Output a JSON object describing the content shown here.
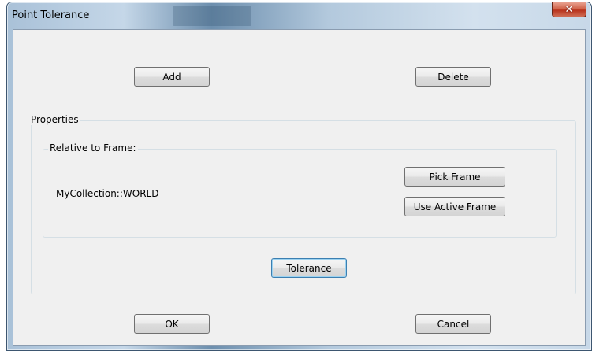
{
  "window": {
    "title": "Point Tolerance",
    "close_icon": "close-icon"
  },
  "top_buttons": {
    "add_label": "Add",
    "delete_label": "Delete"
  },
  "properties": {
    "group_label": "Properties",
    "relative_to_frame": {
      "group_label": "Relative to Frame:",
      "frame_name": "MyCollection::WORLD",
      "pick_frame_label": "Pick Frame",
      "use_active_frame_label": "Use Active Frame"
    },
    "tolerance_label": "Tolerance"
  },
  "bottom_buttons": {
    "ok_label": "OK",
    "cancel_label": "Cancel"
  }
}
